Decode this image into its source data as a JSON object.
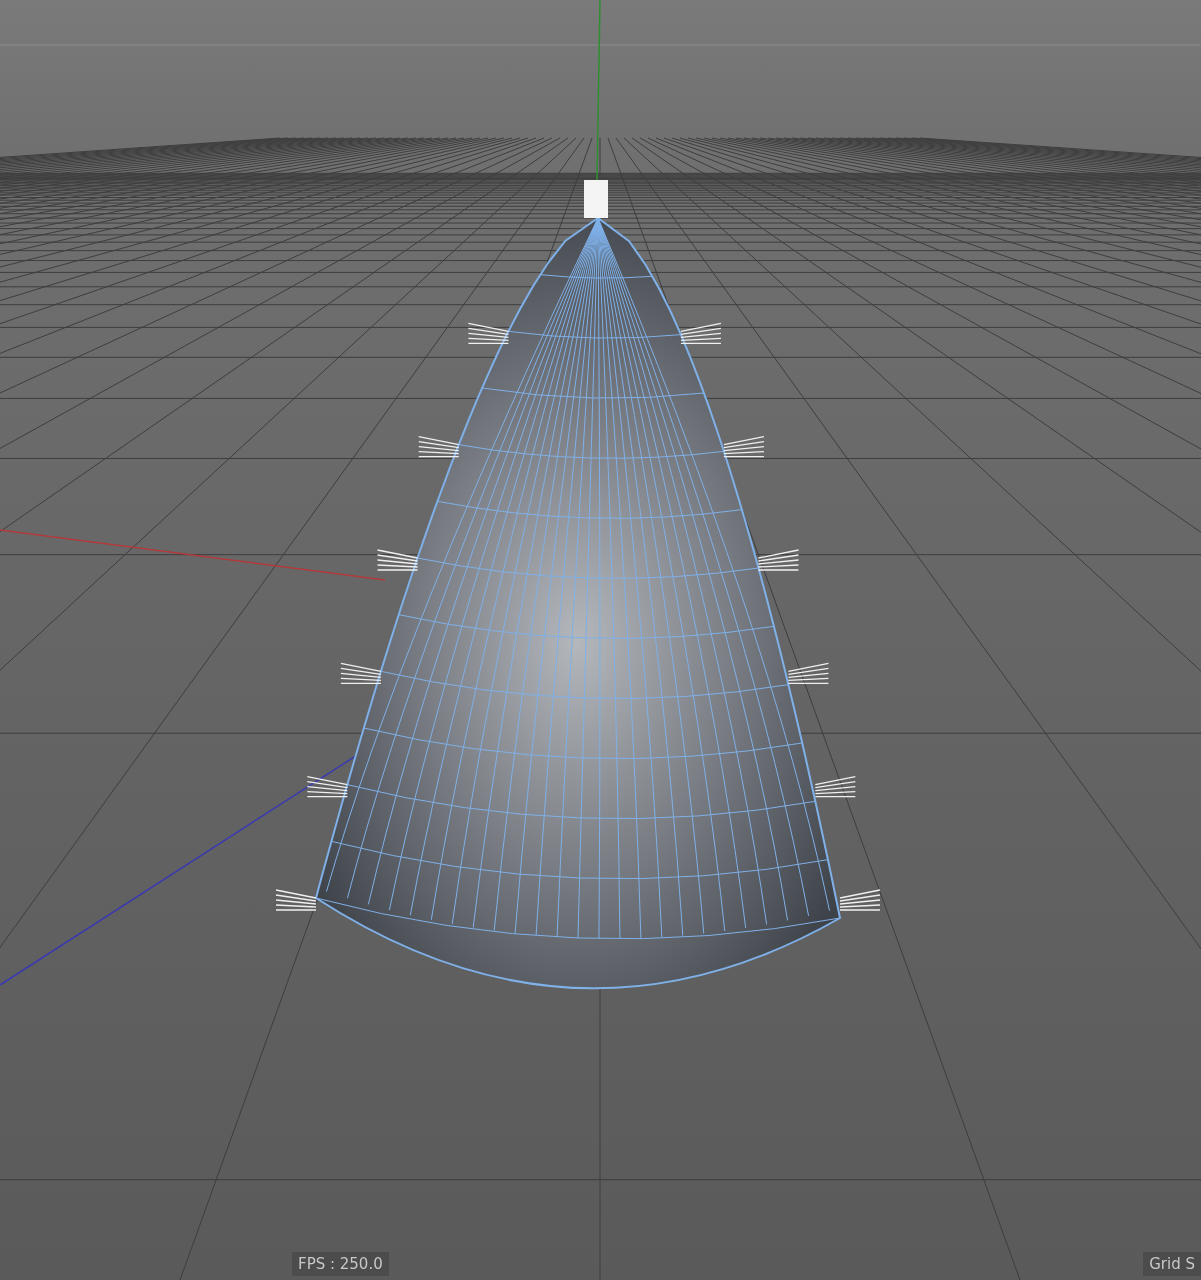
{
  "viewport": {
    "fps_label": "FPS : 250.0",
    "grid_label": "Grid S"
  }
}
